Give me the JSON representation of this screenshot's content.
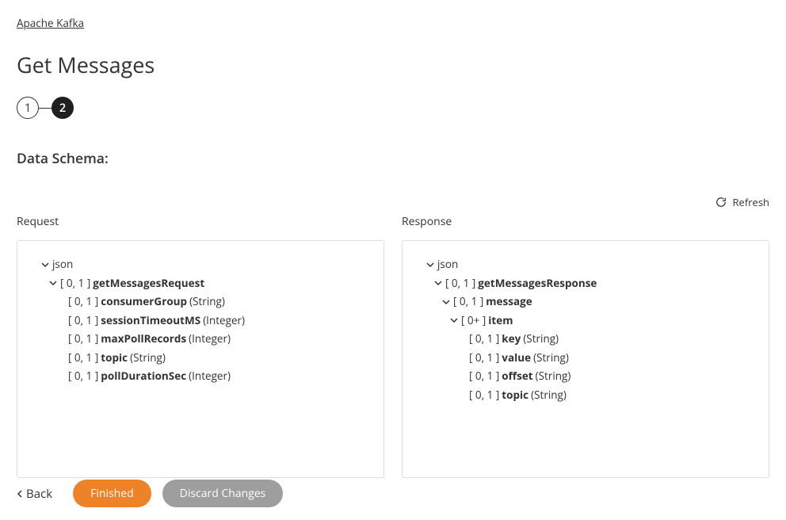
{
  "breadcrumb": "Apache Kafka",
  "page_title": "Get Messages",
  "stepper": {
    "step1": "1",
    "step2": "2"
  },
  "section_title": "Data Schema:",
  "refresh_label": "Refresh",
  "panels": {
    "request_label": "Request",
    "response_label": "Response"
  },
  "request_tree": {
    "root": "json",
    "n0": {
      "card": "[ 0, 1 ]",
      "name": "getMessagesRequest"
    },
    "n1": {
      "card": "[ 0, 1 ]",
      "name": "consumerGroup",
      "type": "(String)"
    },
    "n2": {
      "card": "[ 0, 1 ]",
      "name": "sessionTimeoutMS",
      "type": "(Integer)"
    },
    "n3": {
      "card": "[ 0, 1 ]",
      "name": "maxPollRecords",
      "type": "(Integer)"
    },
    "n4": {
      "card": "[ 0, 1 ]",
      "name": "topic",
      "type": "(String)"
    },
    "n5": {
      "card": "[ 0, 1 ]",
      "name": "pollDurationSec",
      "type": "(Integer)"
    }
  },
  "response_tree": {
    "root": "json",
    "n0": {
      "card": "[ 0, 1 ]",
      "name": "getMessagesResponse"
    },
    "n1": {
      "card": "[ 0, 1 ]",
      "name": "message"
    },
    "n2": {
      "card": "[ 0+ ]",
      "name": "item"
    },
    "n3": {
      "card": "[ 0, 1 ]",
      "name": "key",
      "type": "(String)"
    },
    "n4": {
      "card": "[ 0, 1 ]",
      "name": "value",
      "type": "(String)"
    },
    "n5": {
      "card": "[ 0, 1 ]",
      "name": "offset",
      "type": "(String)"
    },
    "n6": {
      "card": "[ 0, 1 ]",
      "name": "topic",
      "type": "(String)"
    }
  },
  "footer": {
    "back": "Back",
    "finished": "Finished",
    "discard": "Discard Changes"
  }
}
